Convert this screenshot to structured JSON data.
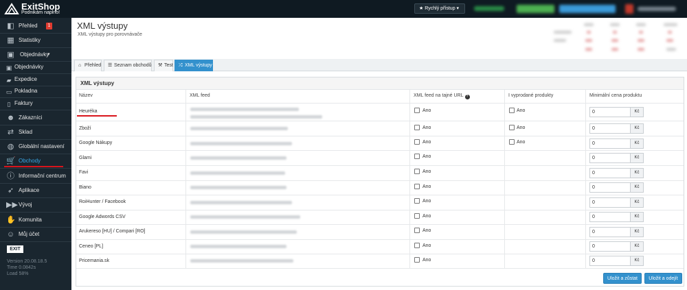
{
  "app": {
    "name": "ExitShop",
    "tagline": "Podnikám naplno!",
    "quick_access": "Rychlý přístup"
  },
  "sidebar": {
    "items": [
      {
        "label": "Přehled",
        "icon": "dashboard-icon",
        "badge": "1"
      },
      {
        "label": "Statistiky",
        "icon": "calendar-icon"
      },
      {
        "label": "Objednávky",
        "icon": "orders-icon"
      },
      {
        "label": "Objednávky",
        "icon": "orders-sub-icon"
      },
      {
        "label": "Expedice",
        "icon": "truck-icon"
      },
      {
        "label": "Pokladna",
        "icon": "monitor-icon"
      },
      {
        "label": "Faktury",
        "icon": "file-icon"
      },
      {
        "label": "Zákazníci",
        "icon": "users-icon"
      },
      {
        "label": "Sklad",
        "icon": "exchange-icon"
      },
      {
        "label": "Globální nastavení",
        "icon": "globe-icon"
      },
      {
        "label": "Obchody",
        "icon": "cart-icon",
        "active": true
      },
      {
        "label": "Informační centrum",
        "icon": "info-icon"
      },
      {
        "label": "Aplikace",
        "icon": "rocket-icon"
      },
      {
        "label": "Vývoj",
        "icon": "forward-icon"
      },
      {
        "label": "Komunita",
        "icon": "community-icon"
      },
      {
        "label": "Můj účet",
        "icon": "user-icon"
      }
    ],
    "exit_logo": "EXIT",
    "version": "Version 20.08.18.5",
    "time": "Time 0.0842s",
    "load": "Load 58%"
  },
  "page": {
    "title": "XML výstupy",
    "subtitle": "XML výstupy pro porovnávače"
  },
  "tabs": [
    {
      "label": "Přehled",
      "icon": "home-icon"
    },
    {
      "label": "Seznam obchodů",
      "icon": "list-icon"
    },
    {
      "label": "Test",
      "icon": "test-icon"
    },
    {
      "label": "XML výstupy",
      "icon": "shuffle-icon",
      "active": true
    }
  ],
  "panel": {
    "title": "XML výstupy",
    "columns": [
      "Název",
      "XML feed",
      "XML feed na tajné URL",
      "I vyprodané produkty",
      "Minimální cena produktu"
    ]
  },
  "rows": [
    {
      "name": "Heuréka",
      "secret": "Ano",
      "soldout": "Ano",
      "price": "0",
      "unit": "Kč"
    },
    {
      "name": "Zboží",
      "secret": "Ano",
      "soldout": "Ano",
      "price": "0",
      "unit": "Kč"
    },
    {
      "name": "Google Nákupy",
      "secret": "Ano",
      "soldout": "Ano",
      "price": "0",
      "unit": "Kč"
    },
    {
      "name": "Glami",
      "secret": "Ano",
      "price": "0",
      "unit": "Kč"
    },
    {
      "name": "Favi",
      "secret": "Ano",
      "price": "0",
      "unit": "Kč"
    },
    {
      "name": "Biano",
      "secret": "Ano",
      "price": "0",
      "unit": "Kč"
    },
    {
      "name": "RoiHunter / Facebook",
      "secret": "Ano",
      "price": "0",
      "unit": "Kč"
    },
    {
      "name": "Google Adwords CSV",
      "secret": "Ano",
      "price": "0",
      "unit": "Kč"
    },
    {
      "name": "Arukereso [HU] / Compari [RO]",
      "secret": "Ano",
      "price": "0",
      "unit": "Kč"
    },
    {
      "name": "Ceneo [PL]",
      "secret": "Ano",
      "price": "0",
      "unit": "Kč"
    },
    {
      "name": "Pricemania.sk",
      "secret": "Ano",
      "price": "0",
      "unit": "Kč"
    }
  ],
  "buttons": {
    "save_stay": "Uložit a zůstat",
    "save_leave": "Uložit a odejít"
  },
  "colors": {
    "topbar": "#0f1a22",
    "sidebar": "#1a262f",
    "accent": "#3391cd",
    "active_nav": "#39a7e6",
    "highlight": "#d9141b"
  }
}
